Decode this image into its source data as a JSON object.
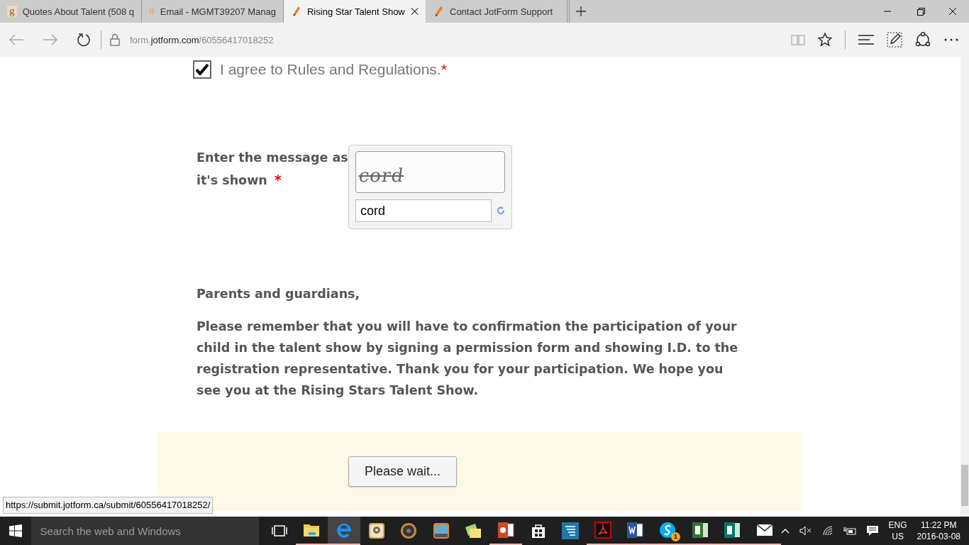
{
  "browser": {
    "tabs": [
      {
        "label": "Quotes About Talent (508 q",
        "selected": false,
        "kind": "letter",
        "favicon_text": "g"
      },
      {
        "label": "Email - MGMT39207 Manag",
        "selected": false,
        "kind": "asterisk"
      },
      {
        "label": "Rising Star Talent Show",
        "selected": true,
        "kind": "pencil"
      },
      {
        "label": "Contact JotForm Support",
        "selected": false,
        "kind": "pencil"
      }
    ],
    "url": {
      "prefix": "form.",
      "domain": "jotform.com",
      "path": "/60556417018252"
    }
  },
  "form": {
    "agree": {
      "label": "I agree to Rules and Regulations.",
      "required_mark": "*",
      "checked": true
    },
    "captcha": {
      "label": "Enter the message as it's shown",
      "required_mark": "*",
      "image_text": "cord",
      "value": "cord"
    },
    "notice": {
      "heading": "Parents and guardians,",
      "body": "Please remember that you will have to confirmation the participation of your child in the talent show by signing a permission form and showing I.D. to the registration representative. Thank you for your participation. We hope you see you at the Rising Stars Talent Show."
    },
    "submit": {
      "label": "Please wait..."
    }
  },
  "status_url": "https://submit.jotform.ca/submit/60556417018252/",
  "taskbar": {
    "search_placeholder": "Search the web and Windows",
    "apps": [
      {
        "kind": "taskview",
        "running": false,
        "selected": false
      },
      {
        "kind": "folder",
        "running": true,
        "selected": false
      },
      {
        "kind": "edge",
        "running": true,
        "selected": true
      },
      {
        "kind": "projector",
        "running": false,
        "selected": false
      },
      {
        "kind": "speaker",
        "running": false,
        "selected": false
      },
      {
        "kind": "docbox",
        "running": false,
        "selected": false
      },
      {
        "kind": "notes",
        "running": false,
        "selected": false
      },
      {
        "kind": "slides",
        "running": true,
        "selected": false
      },
      {
        "kind": "store",
        "running": false,
        "selected": false
      },
      {
        "kind": "stripes",
        "running": false,
        "selected": false
      },
      {
        "kind": "pdf",
        "running": true,
        "selected": false
      },
      {
        "kind": "doc",
        "running": true,
        "selected": false
      },
      {
        "kind": "chat",
        "running": true,
        "selected": false,
        "badge": "1"
      },
      {
        "kind": "greensheet",
        "running": true,
        "selected": false
      },
      {
        "kind": "tealsheet",
        "running": true,
        "selected": false
      },
      {
        "kind": "mail",
        "running": true,
        "selected": false
      }
    ],
    "tray": {
      "language": "ENG",
      "region": "US",
      "time": "11:22 PM",
      "date": "2016-03-08"
    }
  }
}
